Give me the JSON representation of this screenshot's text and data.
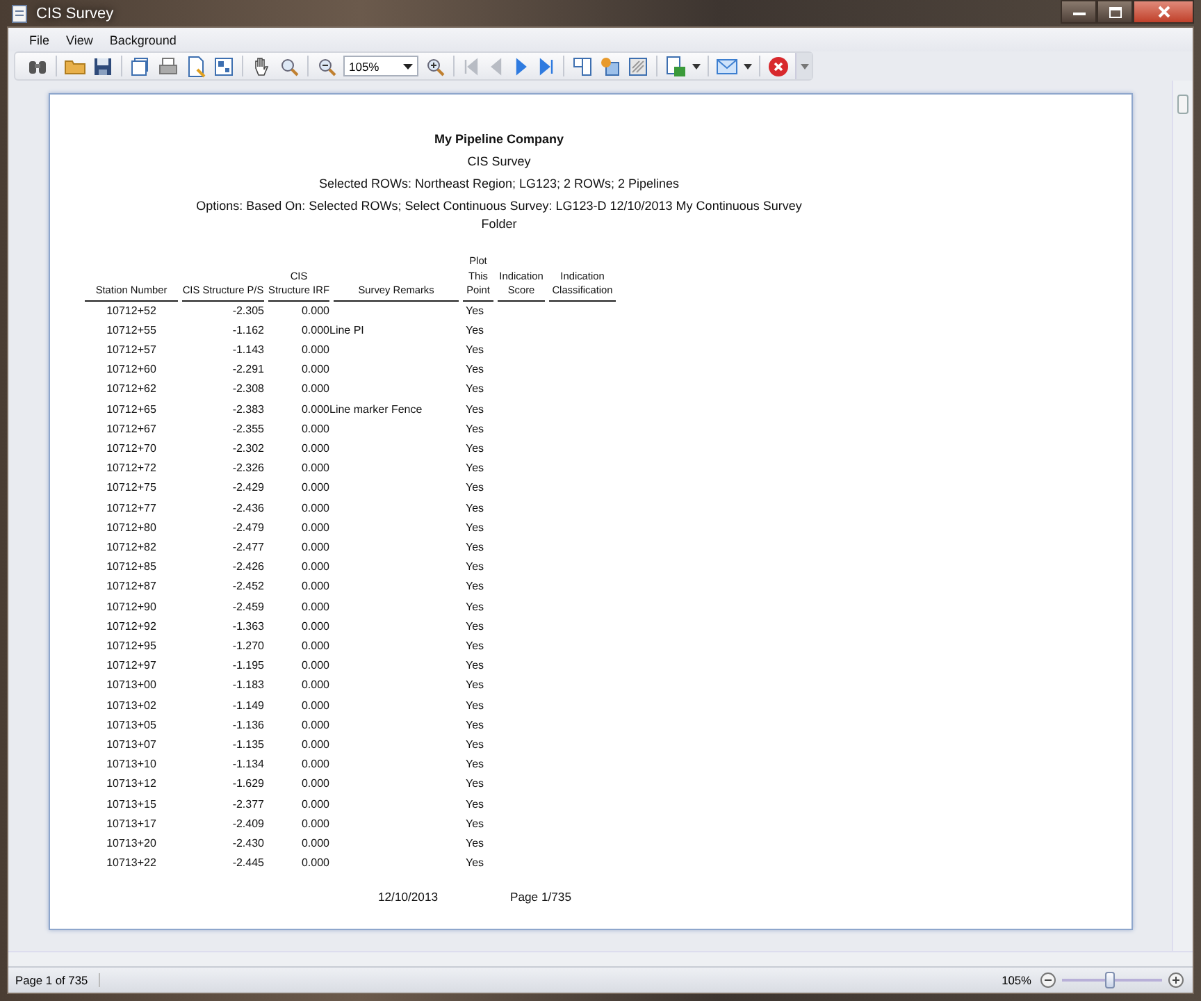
{
  "window": {
    "title": "CIS Survey"
  },
  "menu": [
    {
      "label": "File"
    },
    {
      "label": "View"
    },
    {
      "label": "Background"
    }
  ],
  "toolbar": {
    "zoom_value": "105%",
    "nav_buttons": [
      {
        "kind": "first",
        "disabled": true
      },
      {
        "kind": "prev",
        "disabled": true
      },
      {
        "kind": "next",
        "disabled": false
      },
      {
        "kind": "last",
        "disabled": false
      }
    ]
  },
  "report": {
    "company": "My Pipeline Company",
    "title": "CIS Survey",
    "selection": "Selected ROWs: Northeast Region; LG123; 2 ROWs; 2 Pipelines",
    "options": "Options: Based On: Selected ROWs; Select Continuous Survey: LG123-D  12/10/2013  My Continuous Survey Folder",
    "columns": [
      "Station Number",
      "CIS Structure P/S",
      "CIS Structure IRF",
      "Survey Remarks",
      "Plot This Point",
      "Indication Score",
      "Indication Classification"
    ],
    "rows": [
      {
        "station": "10712+52",
        "ps": "-2.305",
        "irf": "0.000",
        "plot": "Yes"
      },
      {
        "station": "10712+55",
        "ps": "-1.162",
        "irf": "0.000",
        "remarks": "Line PI",
        "plot": "Yes"
      },
      {
        "station": "10712+57",
        "ps": "-1.143",
        "irf": "0.000",
        "plot": "Yes"
      },
      {
        "station": "10712+60",
        "ps": "-2.291",
        "irf": "0.000",
        "plot": "Yes"
      },
      {
        "station": "10712+62",
        "ps": "-2.308",
        "irf": "0.000",
        "plot": "Yes"
      },
      {
        "station": "10712+65",
        "ps": "-2.383",
        "irf": "0.000",
        "remarks": "Line marker Fence",
        "plot": "Yes"
      },
      {
        "station": "10712+67",
        "ps": "-2.355",
        "irf": "0.000",
        "plot": "Yes"
      },
      {
        "station": "10712+70",
        "ps": "-2.302",
        "irf": "0.000",
        "plot": "Yes"
      },
      {
        "station": "10712+72",
        "ps": "-2.326",
        "irf": "0.000",
        "plot": "Yes"
      },
      {
        "station": "10712+75",
        "ps": "-2.429",
        "irf": "0.000",
        "plot": "Yes"
      },
      {
        "station": "10712+77",
        "ps": "-2.436",
        "irf": "0.000",
        "plot": "Yes"
      },
      {
        "station": "10712+80",
        "ps": "-2.479",
        "irf": "0.000",
        "plot": "Yes"
      },
      {
        "station": "10712+82",
        "ps": "-2.477",
        "irf": "0.000",
        "plot": "Yes"
      },
      {
        "station": "10712+85",
        "ps": "-2.426",
        "irf": "0.000",
        "plot": "Yes"
      },
      {
        "station": "10712+87",
        "ps": "-2.452",
        "irf": "0.000",
        "plot": "Yes"
      },
      {
        "station": "10712+90",
        "ps": "-2.459",
        "irf": "0.000",
        "plot": "Yes"
      },
      {
        "station": "10712+92",
        "ps": "-1.363",
        "irf": "0.000",
        "plot": "Yes"
      },
      {
        "station": "10712+95",
        "ps": "-1.270",
        "irf": "0.000",
        "plot": "Yes"
      },
      {
        "station": "10712+97",
        "ps": "-1.195",
        "irf": "0.000",
        "plot": "Yes"
      },
      {
        "station": "10713+00",
        "ps": "-1.183",
        "irf": "0.000",
        "plot": "Yes"
      },
      {
        "station": "10713+02",
        "ps": "-1.149",
        "irf": "0.000",
        "plot": "Yes"
      },
      {
        "station": "10713+05",
        "ps": "-1.136",
        "irf": "0.000",
        "plot": "Yes"
      },
      {
        "station": "10713+07",
        "ps": "-1.135",
        "irf": "0.000",
        "plot": "Yes"
      },
      {
        "station": "10713+10",
        "ps": "-1.134",
        "irf": "0.000",
        "plot": "Yes"
      },
      {
        "station": "10713+12",
        "ps": "-1.629",
        "irf": "0.000",
        "plot": "Yes"
      },
      {
        "station": "10713+15",
        "ps": "-2.377",
        "irf": "0.000",
        "plot": "Yes"
      },
      {
        "station": "10713+17",
        "ps": "-2.409",
        "irf": "0.000",
        "plot": "Yes"
      },
      {
        "station": "10713+20",
        "ps": "-2.430",
        "irf": "0.000",
        "plot": "Yes"
      },
      {
        "station": "10713+22",
        "ps": "-2.445",
        "irf": "0.000",
        "plot": "Yes"
      }
    ],
    "footer_date": "12/10/2013",
    "footer_page": "Page 1/735"
  },
  "status_bar": {
    "page": "Page 1 of 735",
    "zoom": "105%",
    "level": 0.47
  }
}
